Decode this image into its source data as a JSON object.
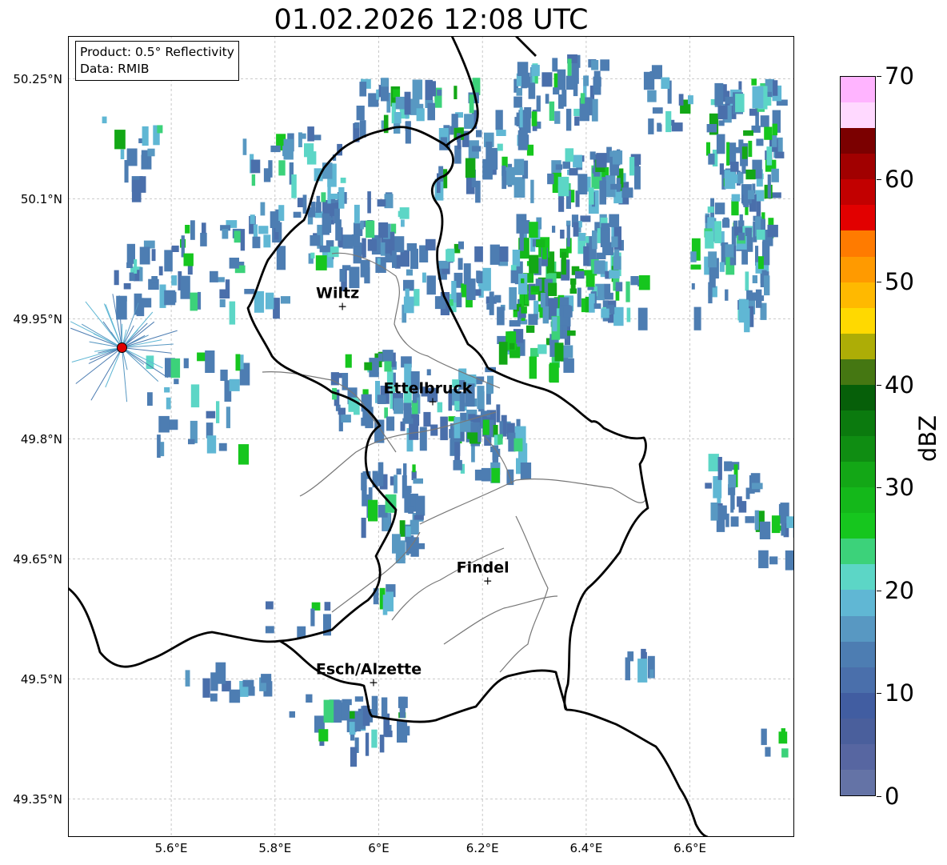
{
  "title": "01.02.2026 12:08 UTC",
  "info": {
    "product_line": "Product: 0.5° Reflectivity",
    "data_line": "Data: RMIB"
  },
  "map_extent": {
    "lon_min": 5.4,
    "lon_max": 6.8,
    "lat_min": 49.29,
    "lat_max": 50.32
  },
  "lat_ticks": [
    {
      "value": 50.25,
      "label": "50.25°N"
    },
    {
      "value": 50.1,
      "label": "50.1°N"
    },
    {
      "value": 49.95,
      "label": "49.95°N"
    },
    {
      "value": 49.8,
      "label": "49.8°N"
    },
    {
      "value": 49.65,
      "label": "49.65°N"
    },
    {
      "value": 49.5,
      "label": "49.5°N"
    },
    {
      "value": 49.35,
      "label": "49.35°N"
    }
  ],
  "lon_ticks": [
    {
      "value": 5.6,
      "label": "5.6°E"
    },
    {
      "value": 5.8,
      "label": "5.8°E"
    },
    {
      "value": 6.0,
      "label": "6°E"
    },
    {
      "value": 6.2,
      "label": "6.2°E"
    },
    {
      "value": 6.4,
      "label": "6.4°E"
    },
    {
      "value": 6.6,
      "label": "6.6°E"
    }
  ],
  "cities": [
    {
      "name": "Wiltz",
      "lon": 5.93,
      "lat": 49.966
    },
    {
      "name": "Ettelbruck",
      "lon": 6.104,
      "lat": 49.847
    },
    {
      "name": "Findel",
      "lon": 6.21,
      "lat": 49.623
    },
    {
      "name": "Esch/Alzette",
      "lon": 5.99,
      "lat": 49.496
    }
  ],
  "radar_site": {
    "lon": 5.505,
    "lat": 49.914,
    "color": "#e00000"
  },
  "colorbar": {
    "label": "dBZ",
    "min": 0,
    "max": 70,
    "step": 2.5,
    "tick_labels": [
      "0",
      "10",
      "20",
      "30",
      "40",
      "50",
      "60",
      "70"
    ],
    "colors": [
      "#6473a6",
      "#5766a1",
      "#4a5f9c",
      "#415da1",
      "#4a6fab",
      "#4d7db2",
      "#5898c2",
      "#60b7d4",
      "#5cd6c6",
      "#3cd27a",
      "#16c61e",
      "#14b81a",
      "#13a716",
      "#0f8d12",
      "#0b7a0e",
      "#065f09",
      "#457712",
      "#adad06",
      "#ffd900",
      "#ffb900",
      "#ff9a00",
      "#ff7b00",
      "#e20000",
      "#c20000",
      "#a10000",
      "#7b0000",
      "#ffd9ff",
      "#ffb4ff",
      "#ff6eff",
      "#ea36ea"
    ]
  }
}
